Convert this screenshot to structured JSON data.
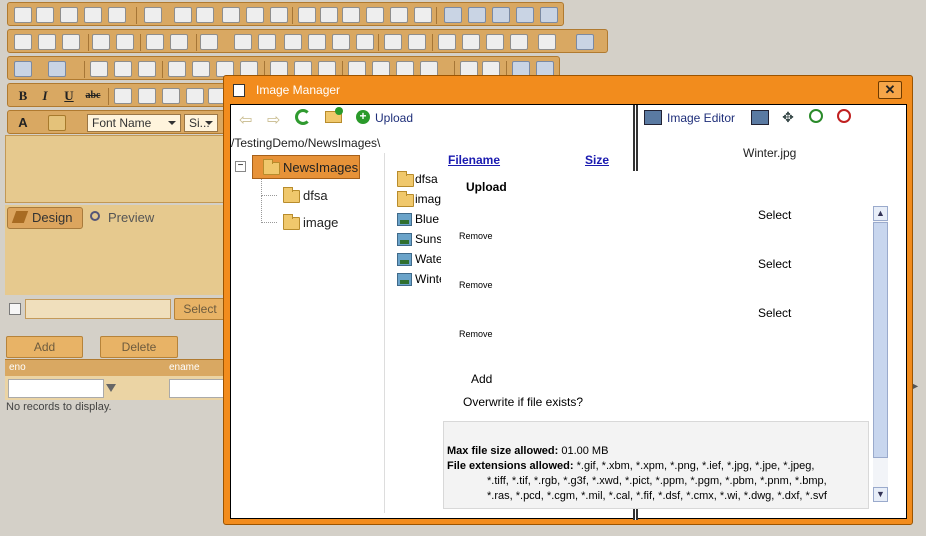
{
  "editor": {
    "font_name": "Font Name",
    "font_size": "Si...",
    "mode_design": "Design",
    "mode_preview": "Preview",
    "select_button": "Select",
    "add_button": "Add",
    "delete_button": "Delete",
    "grid_columns": [
      "eno",
      "ename"
    ],
    "no_records": "No records to display."
  },
  "dialog": {
    "title": "Image Manager",
    "close_icon": "close-icon",
    "upload_label": "Upload",
    "path": "/TestingDemo/NewsImages\\",
    "tree": {
      "root": "NewsImages",
      "children": [
        "dfsa",
        "image"
      ]
    },
    "file_list": {
      "headers": {
        "filename": "Filename",
        "size": "Size"
      },
      "items": [
        {
          "name": "dfsa",
          "type": "folder"
        },
        {
          "name": "image",
          "type": "folder"
        },
        {
          "name": "Blue",
          "type": "image"
        },
        {
          "name": "Suns",
          "type": "image"
        },
        {
          "name": "Wate",
          "type": "image"
        },
        {
          "name": "Winte",
          "type": "image"
        }
      ]
    },
    "image_editor_label": "Image Editor",
    "preview_filename": "Winter.jpg",
    "upload_panel": {
      "title": "Upload",
      "rows": [
        {
          "select": "Select",
          "remove": "Remove"
        },
        {
          "select": "Select",
          "remove": "Remove"
        },
        {
          "select": "Select",
          "remove": "Remove"
        }
      ],
      "add": "Add",
      "overwrite": "Overwrite if file exists?",
      "max_size_label": "Max file size allowed:",
      "max_size_value": "01.00 MB",
      "extensions_label": "File extensions allowed:",
      "extensions_line1": "*.gif, *.xbm, *.xpm, *.png, *.ief, *.jpg, *.jpe, *.jpeg,",
      "extensions_line2": "*.tiff, *.tif, *.rgb, *.g3f, *.xwd, *.pict, *.ppm, *.pgm, *.pbm, *.pnm, *.bmp,",
      "extensions_line3": "*.ras, *.pcd, *.cgm, *.mil, *.cal, *.fif, *.dsf, *.cmx, *.wi, *.dwg, *.dxf, *.svf"
    }
  },
  "colors": {
    "dialog_border": "#f28c1d",
    "toolbar": "#d9a862",
    "link": "#1a1ab0"
  }
}
